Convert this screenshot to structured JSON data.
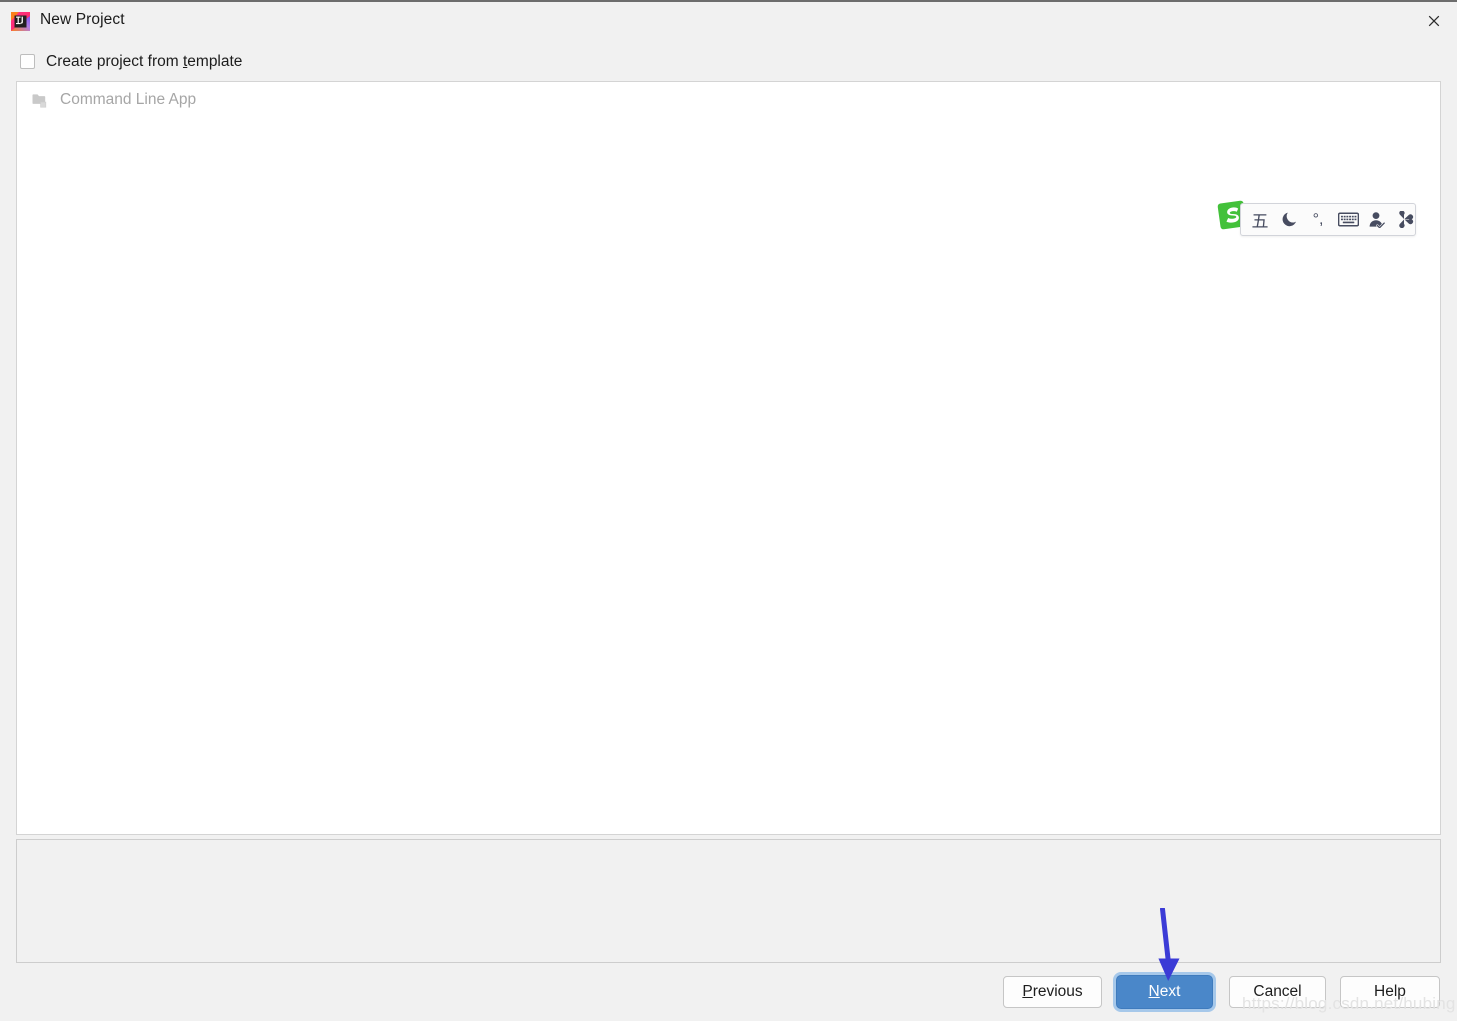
{
  "window": {
    "title": "New Project",
    "app_icon": "intellij-idea-icon",
    "close_icon": "close-icon"
  },
  "options": {
    "template_checkbox_label_before": "Create project from ",
    "template_checkbox_mnemonic": "t",
    "template_checkbox_label_after": "emplate",
    "template_checkbox_checked": false
  },
  "list": {
    "items": [
      {
        "label": "Command Line App",
        "icon": "folder-icon",
        "enabled": false
      }
    ]
  },
  "buttons": {
    "previous": {
      "before": "",
      "mnemonic": "P",
      "after": "revious"
    },
    "next": {
      "before": "",
      "mnemonic": "N",
      "after": "ext"
    },
    "cancel": {
      "before": "Cancel",
      "mnemonic": "",
      "after": ""
    },
    "help": {
      "before": "Help",
      "mnemonic": "",
      "after": ""
    }
  },
  "ime_toolbar": {
    "logo": "sogou-s-logo-icon",
    "mode_label": "五",
    "items": [
      {
        "name": "wubi-mode",
        "glyph": "五"
      },
      {
        "name": "moon-icon",
        "glyph": ""
      },
      {
        "name": "punctuation-mode-icon",
        "glyph": "°,"
      },
      {
        "name": "keyboard-icon",
        "glyph": ""
      },
      {
        "name": "user-icon",
        "glyph": ""
      },
      {
        "name": "toolbox-icon",
        "glyph": ""
      }
    ]
  },
  "annotation": {
    "arrow_color": "#3b3bd6",
    "points_to": "next-button"
  },
  "watermark": {
    "text": "https://blog.csdn.net/hubing"
  },
  "colors": {
    "dialog_background": "#f1f1f1",
    "panel_background": "#ffffff",
    "primary_button": "#4a87c9",
    "primary_button_ring": "#a6c8ea",
    "disabled_text": "#a6a6a6",
    "border": "#d4d4d4"
  }
}
